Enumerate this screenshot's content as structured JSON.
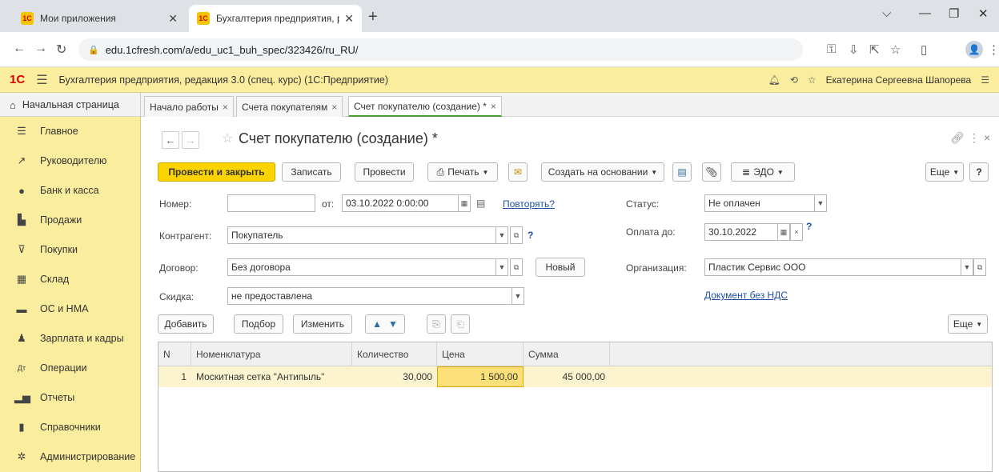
{
  "browser": {
    "tabs": [
      {
        "label": "Мои приложения",
        "favicon": "1С"
      },
      {
        "label": "Бухгалтерия предприятия, реда",
        "favicon": "1С"
      }
    ],
    "url": "edu.1cfresh.com/a/edu_uc1_buh_spec/323426/ru_RU/"
  },
  "app": {
    "logo": "1С",
    "title": "Бухгалтерия предприятия, редакция 3.0 (спец. курс)  (1С:Предприятие)",
    "user": "Екатерина Сергеевна Шапорева"
  },
  "tabs": {
    "home": "Начальная страница",
    "items": [
      {
        "label": "Начало работы"
      },
      {
        "label": "Счета покупателям"
      },
      {
        "label": "Счет покупателю (создание) *"
      }
    ]
  },
  "sidebar": {
    "items": [
      {
        "label": "Главное"
      },
      {
        "label": "Руководителю"
      },
      {
        "label": "Банк и касса"
      },
      {
        "label": "Продажи"
      },
      {
        "label": "Покупки"
      },
      {
        "label": "Склад"
      },
      {
        "label": "ОС и НМА"
      },
      {
        "label": "Зарплата и кадры"
      },
      {
        "label": "Операции"
      },
      {
        "label": "Отчеты"
      },
      {
        "label": "Справочники"
      },
      {
        "label": "Администрирование"
      }
    ]
  },
  "form": {
    "title": "Счет покупателю (создание) *",
    "toolbar": {
      "post_close": "Провести и закрыть",
      "save": "Записать",
      "post": "Провести",
      "print": "Печать",
      "create_based": "Создать на основании",
      "edo": "ЭДО",
      "more": "Еще",
      "help": "?"
    },
    "number_label": "Номер:",
    "number_value": "",
    "from_label": "от:",
    "date_value": "03.10.2022  0:00:00",
    "repeat_link": "Повторять?",
    "status_label": "Статус:",
    "status_value": "Не оплачен",
    "contractor_label": "Контрагент:",
    "contractor_value": "Покупатель",
    "pay_until_label": "Оплата до:",
    "pay_until_value": "30.10.2022",
    "contract_label": "Договор:",
    "contract_value": "Без договора",
    "new_button": "Новый",
    "org_label": "Организация:",
    "org_value": "Пластик Сервис ООО",
    "discount_label": "Скидка:",
    "discount_value": "не предоставлена",
    "vat_link": "Документ без НДС",
    "table_toolbar": {
      "add": "Добавить",
      "pick": "Подбор",
      "change": "Изменить",
      "more": "Еще"
    },
    "table": {
      "columns": [
        "N",
        "Номенклатура",
        "Количество",
        "Цена",
        "Сумма"
      ],
      "rows": [
        {
          "n": "1",
          "item": "Москитная сетка \"Антипыль\"",
          "qty": "30,000",
          "price": "1 500,00",
          "sum": "45 000,00"
        }
      ]
    }
  },
  "colors": {
    "accent_yellow": "#fbd400",
    "sidebar_bg": "#fbed9e",
    "link": "#1e4fa8"
  }
}
